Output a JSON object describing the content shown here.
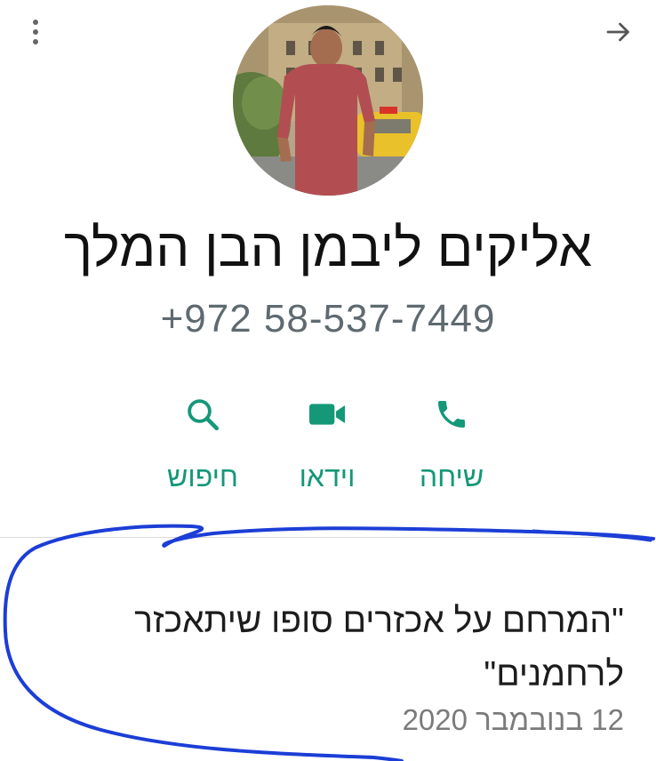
{
  "header": {
    "menu_icon": "more-vert-icon",
    "back_icon": "arrow-forward-icon"
  },
  "contact": {
    "name": "אליקים ליבמן הבן המלך",
    "phone": "+972 58-537-7449"
  },
  "actions": [
    {
      "label": "שיחה",
      "icon": "phone-icon"
    },
    {
      "label": "וידאו",
      "icon": "video-icon"
    },
    {
      "label": "חיפוש",
      "icon": "search-icon"
    }
  ],
  "about": {
    "text": "\"המרחם על אכזרים סופו שיתאכזר לרחמנים\"",
    "date": "12 בנובמבר 2020"
  },
  "colors": {
    "accent": "#149878",
    "annotation": "#1c3ed6"
  }
}
